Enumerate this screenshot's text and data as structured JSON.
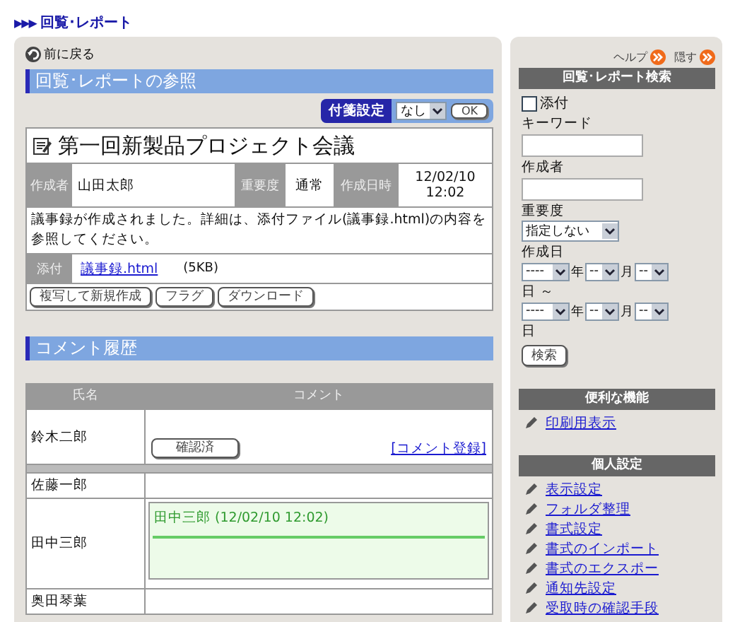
{
  "breadcrumb": {
    "marker": "▶▶▶",
    "title": "回覧･レポート"
  },
  "main": {
    "back_link": "前に戻る",
    "section_title": "回覧･レポートの参照",
    "sticky_note": {
      "label": "付箋設定",
      "value": "なし",
      "button": "OK"
    },
    "report": {
      "title": "第一回新製品プロジェクト会議",
      "fields": [
        {
          "label": "作成者",
          "value": "山田太郎"
        },
        {
          "label": "重要度",
          "value": "通常"
        },
        {
          "label": "作成日時",
          "value": "12/02/10 12:02"
        }
      ],
      "body": "議事録が作成されました。詳細は、添付ファイル(議事録.html)の内容を参照してください。",
      "attachment": {
        "label": "添付",
        "file": "議事録.html",
        "size": "(5KB)"
      },
      "buttons": [
        "複写して新規作成",
        "フラグ",
        "ダウンロード"
      ]
    },
    "comments": {
      "title": "コメント履歴",
      "columns": [
        "氏名",
        "コメント"
      ],
      "rows": [
        {
          "name": "鈴木二郎",
          "kind": "action",
          "button": "確認済",
          "link": "[コメント登録]"
        },
        {
          "name": "佐藤一郎",
          "kind": "empty"
        },
        {
          "name": "田中三郎",
          "kind": "comment",
          "author": "田中三郎 (12/02/10 12:02)"
        },
        {
          "name": "奥田琴葉",
          "kind": "empty"
        }
      ]
    }
  },
  "sidebar": {
    "links": [
      "ヘルプ",
      "隠す"
    ],
    "search": {
      "title": "回覧･レポート検索",
      "attachment": {
        "label": "添付",
        "checked": false
      },
      "keyword": {
        "label": "キーワード"
      },
      "author": {
        "label": "作成者"
      },
      "importance": {
        "label": "重要度",
        "value": "指定しない"
      },
      "created_label": "作成日",
      "date_rows": [
        {
          "year": "----",
          "year_unit": "年",
          "month": "--",
          "month_unit": "月",
          "day": "--",
          "suffix": "日 ～"
        },
        {
          "year": "----",
          "year_unit": "年",
          "month": "--",
          "month_unit": "月",
          "day": "--",
          "suffix": "日"
        }
      ],
      "button": "検索"
    },
    "tools": {
      "title": "便利な機能",
      "items": [
        "印刷用表示"
      ]
    },
    "personal": {
      "title": "個人設定",
      "items": [
        "表示設定",
        "フォルダ整理",
        "書式設定",
        "書式のインポート",
        "書式のエクスポー",
        "通知先設定",
        "受取時の確認手段"
      ]
    }
  }
}
